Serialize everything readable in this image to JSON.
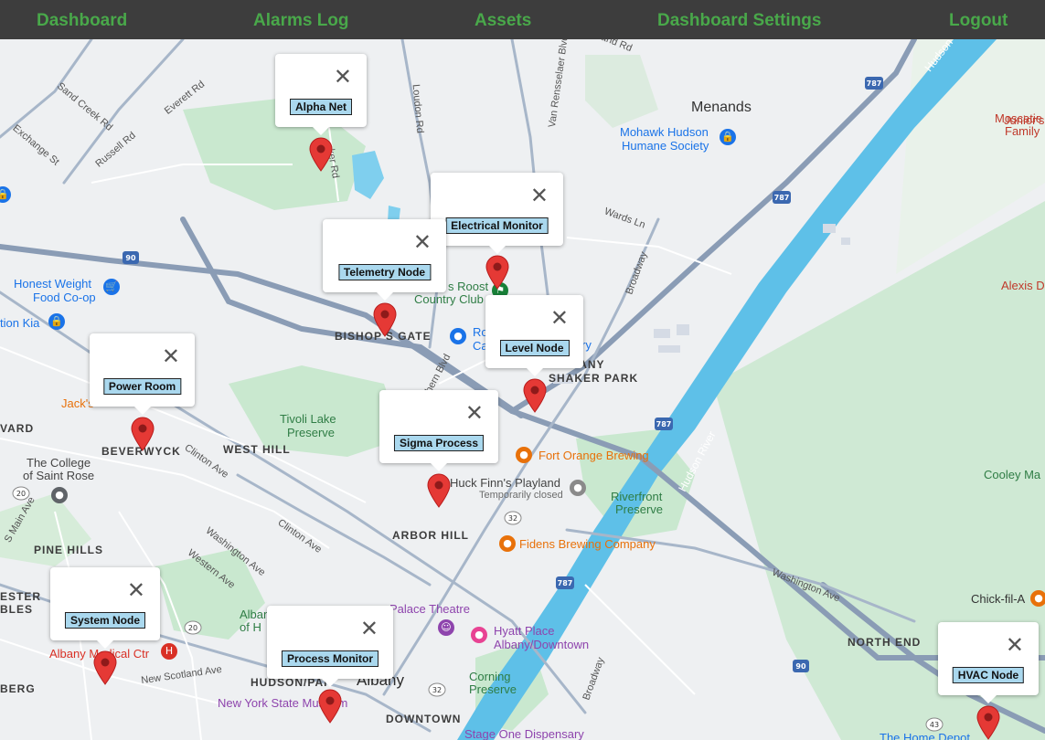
{
  "nav": {
    "dashboard": "Dashboard",
    "alarms_log": "Alarms Log",
    "assets": "Assets",
    "dashboard_settings": "Dashboard Settings",
    "logout": "Logout"
  },
  "colors": {
    "nav_bg": "#3d3d3d",
    "nav_link": "#49a84a",
    "tag_bg": "#aad8ee",
    "pin": "#e53935",
    "river": "#5ec0e8",
    "park": "#c9e8cf"
  },
  "markers": [
    {
      "label": "Alpha Net",
      "icon": "close-icon"
    },
    {
      "label": "Electrical Monitor",
      "icon": "close-icon"
    },
    {
      "label": "Telemetry Node",
      "icon": "close-icon"
    },
    {
      "label": "Level Node",
      "icon": "close-icon"
    },
    {
      "label": "Power Room",
      "icon": "close-icon"
    },
    {
      "label": "Sigma Process",
      "icon": "close-icon"
    },
    {
      "label": "System Node",
      "icon": "close-icon"
    },
    {
      "label": "Process Monitor",
      "icon": "close-icon"
    },
    {
      "label": "HVAC Node",
      "icon": "close-icon"
    }
  ],
  "map": {
    "places": {
      "menands": "Menands",
      "mohawk_hudson": "Mohawk Hudson",
      "humane_society": "Humane Society",
      "juniors": "Junior's Ba",
      "moscatiello": "Moscatie",
      "moscatiello2": "Family",
      "alexis": "Alexis D",
      "honest_weight": "Honest Weight",
      "food_coop": "Food Co-op",
      "kia": "tion Kia",
      "country_club1": "s Roost",
      "country_club2": "Country Club",
      "jacks": "Jack's",
      "college1": "The College",
      "college2": "of Saint Rose",
      "huck_finn": "Huck Finn's Playland",
      "temp_closed": "Temporarily closed",
      "fort_orange": "Fort Orange Brewing",
      "fidens": "Fidens Brewing Company",
      "palace": "Palace Theatre",
      "hyatt1": "Hyatt Place",
      "hyatt2": "Albany/Downtown",
      "albany_medical": "Albany Medical Ctr",
      "nys_museum": "New York State Museum",
      "albany": "Albany",
      "chick": "Chick-fil-A",
      "home_depot": "The Home Depot",
      "stage_one": "Stage One Dispensary",
      "cooley": "Cooley Ma",
      "ro": "Ro",
      "ca": "Ca",
      "ry": "ry",
      "albany_left1": "Alban",
      "albany_left2": "of H"
    },
    "parks": {
      "tivoli1": "Tivoli Lake",
      "tivoli2": "Preserve",
      "riverfront1": "Riverfront",
      "riverfront2": "Preserve",
      "corning1": "Corning",
      "corning2": "Preserve"
    },
    "districts": {
      "bishops_gate": "BISHOP'S GATE",
      "beverwyck": "BEVERWYCK",
      "west_hill": "WEST HILL",
      "arbor_hill": "ARBOR HILL",
      "pine_hills": "PINE HILLS",
      "hudson_park": "HUDSON/PAR",
      "downtown": "DOWNTOWN",
      "north_end": "NORTH END",
      "shaker_park": "SHAKER PARK",
      "n_albany": "H ALBANY",
      "vard": "VARD",
      "esther": "ESTER",
      "bles": "BLES",
      "berg": "BERG"
    },
    "roads": {
      "menand_rd": "Menand Rd",
      "van_rensselaer": "Van Rensselaer Blvd",
      "loudon": "Loudon Rd",
      "everett": "Everett Rd",
      "sand_creek": "Sand Creek Rd",
      "exchange": "Exchange St",
      "russell": "Russell Rd",
      "wards_ln": "Wards Ln",
      "broadway": "Broadway",
      "clinton1": "Clinton Ave",
      "clinton2": "Clinton Ave",
      "washington1": "Washington Ave",
      "washington2": "Washington Ave",
      "western": "Western Ave",
      "new_scotland": "New Scotland Ave",
      "main_ave": "S Main Ave",
      "shaker_rd": "ker Rd",
      "hudson_river_lbl": "Hudson River",
      "hudson_river_top": "Hudson River",
      "northern_blvd": "hern Blvd",
      "broadway2": "Broadway"
    },
    "shields": {
      "i787a": "787",
      "i787b": "787",
      "i787c": "787",
      "i787d": "787",
      "i90a": "90",
      "i90b": "90",
      "r32a": "32",
      "r32b": "32",
      "r20a": "20",
      "r20b": "20",
      "r43": "43"
    }
  }
}
